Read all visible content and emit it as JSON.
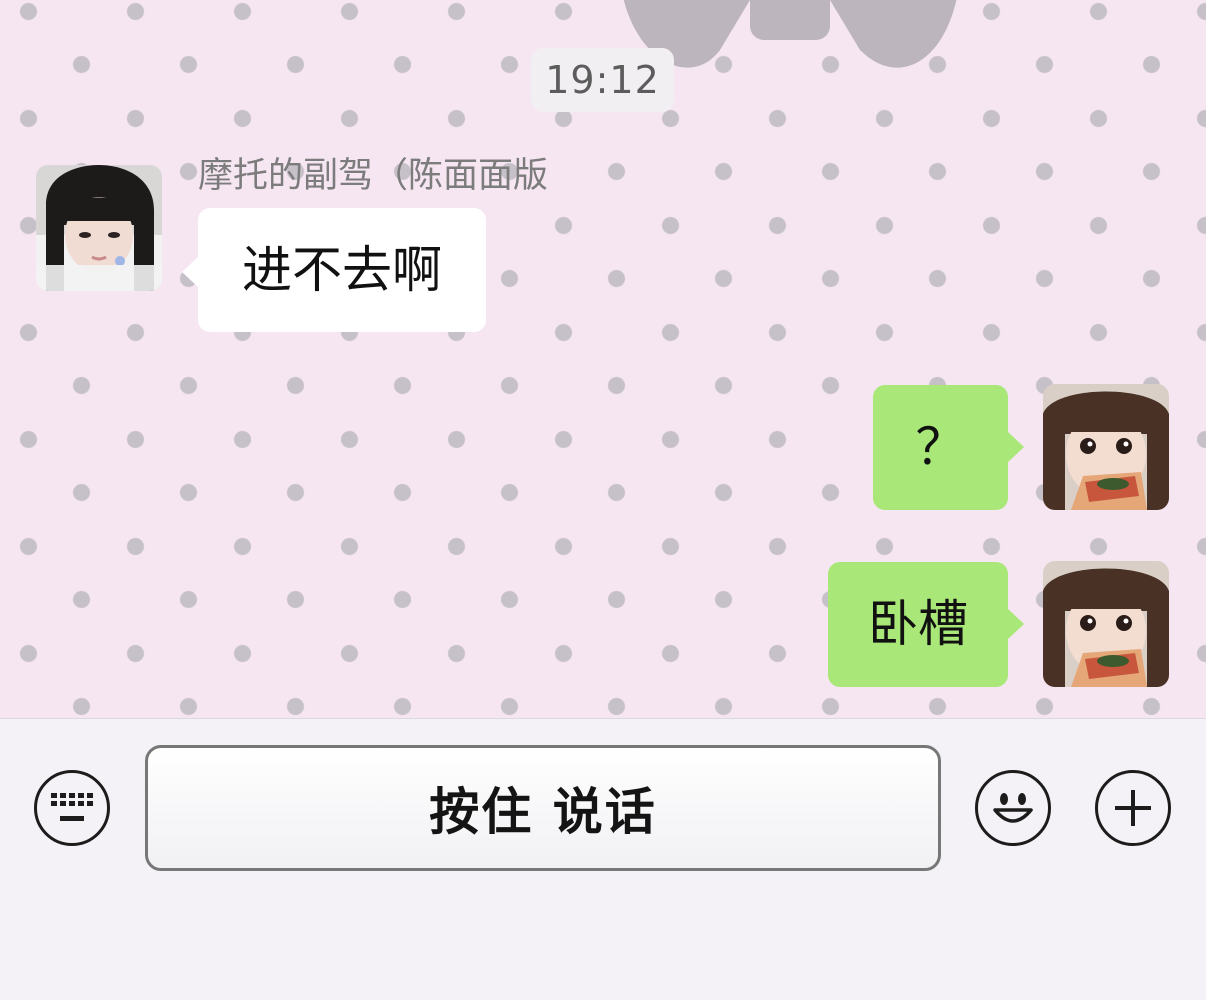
{
  "chat": {
    "timestamp": "19:12",
    "messages": [
      {
        "direction": "incoming",
        "sender": "摩托的副驾（陈面面版",
        "text": "进不去啊"
      },
      {
        "direction": "outgoing",
        "text": "？"
      },
      {
        "direction": "outgoing",
        "text": "卧槽"
      }
    ]
  },
  "input_bar": {
    "hold_to_talk_label": "按住 说话",
    "left_icon": "keyboard-icon",
    "right_icons": [
      "emoji-icon",
      "plus-icon"
    ]
  },
  "colors": {
    "chat_background": "#f6e6f2",
    "dot": "#c6c0c8",
    "incoming_bubble": "#ffffff",
    "outgoing_bubble": "#a9e878",
    "input_bar": "#f4f2f6"
  }
}
